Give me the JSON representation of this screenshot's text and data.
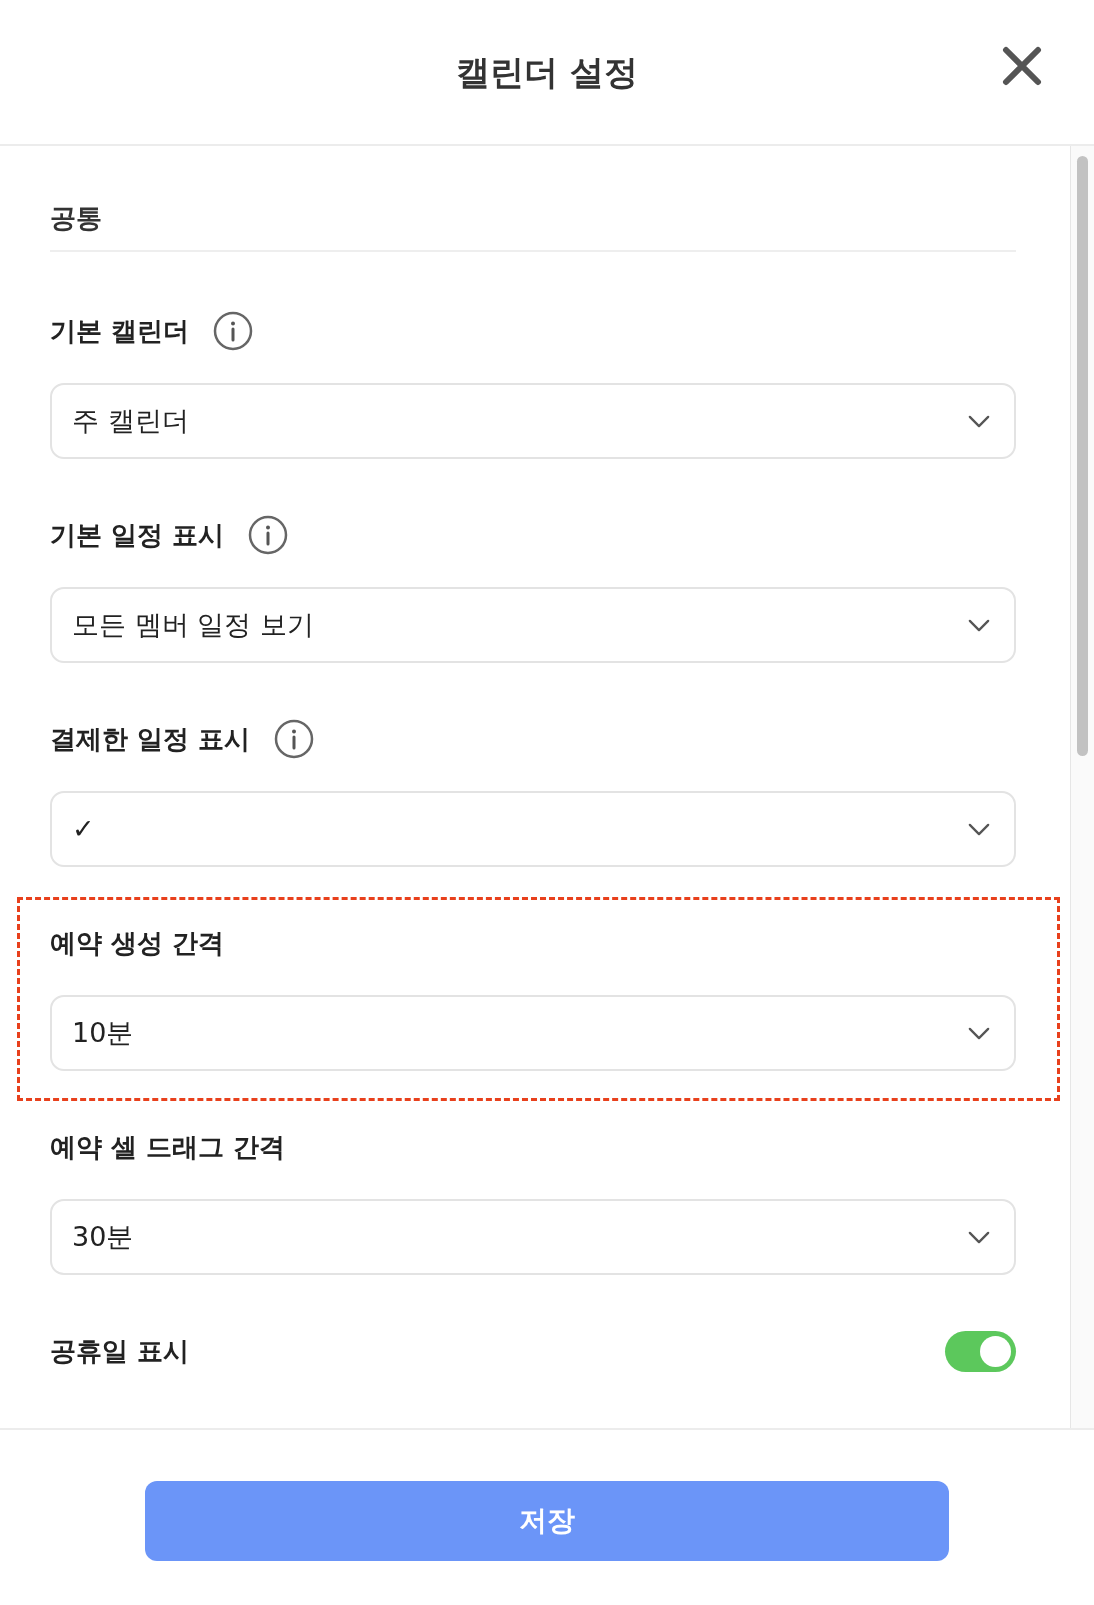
{
  "dialog": {
    "title": "캘린더 설정"
  },
  "section": {
    "title": "공통"
  },
  "fields": [
    {
      "kind": "select",
      "label": "기본 캘린더",
      "info": true,
      "value": "주 캘린더",
      "highlighted": false
    },
    {
      "kind": "select",
      "label": "기본 일정 표시",
      "info": true,
      "value": "모든 멤버 일정 보기",
      "highlighted": false
    },
    {
      "kind": "select",
      "label": "결제한 일정 표시",
      "info": true,
      "value": "✓",
      "highlighted": false
    },
    {
      "kind": "select",
      "label": "예약 생성 간격",
      "info": false,
      "value": "10분",
      "highlighted": true
    },
    {
      "kind": "select",
      "label": "예약 셀 드래그 간격",
      "info": false,
      "value": "30분",
      "highlighted": false
    },
    {
      "kind": "toggle",
      "label": "공휴일 표시",
      "on": true,
      "highlighted": false
    }
  ],
  "save_button": {
    "label": "저장"
  }
}
